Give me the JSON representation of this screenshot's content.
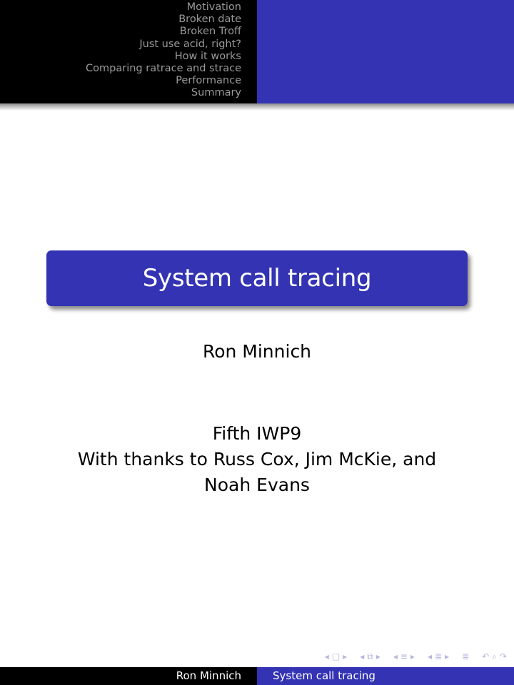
{
  "headline": {
    "sections": [
      {
        "label": "Motivation"
      },
      {
        "label": "Broken date"
      },
      {
        "label": "Broken Troff"
      },
      {
        "label": "Just use acid, right?"
      },
      {
        "label": "How it works"
      },
      {
        "label": "Comparing ratrace and strace"
      },
      {
        "label": "Performance"
      },
      {
        "label": "Summary"
      }
    ]
  },
  "title_slide": {
    "title": "System call tracing",
    "author": "Ron Minnich",
    "institute_lines": [
      "Fifth IWP9",
      "With thanks to Russ Cox, Jim McKie, and",
      "Noah Evans"
    ]
  },
  "nav_symbols": {
    "slide": {
      "left": "◂",
      "icon": "□",
      "right": "▸"
    },
    "frame": {
      "left": "◂",
      "icon": "⧉",
      "right": "▸"
    },
    "subsection": {
      "left": "◂",
      "icon": "≡",
      "right": "▸"
    },
    "section": {
      "left": "◂",
      "icon": "≣",
      "right": "▸"
    },
    "document": {
      "icon": "≣"
    },
    "controls": {
      "back": "↶",
      "search": "⌕",
      "forward": "↷"
    }
  },
  "footline": {
    "author": "Ron Minnich",
    "title": "System call tracing"
  },
  "colors": {
    "theme_blue": "#3333b3",
    "headline_black": "#000000",
    "nav_gray": "#9a9a9a"
  }
}
